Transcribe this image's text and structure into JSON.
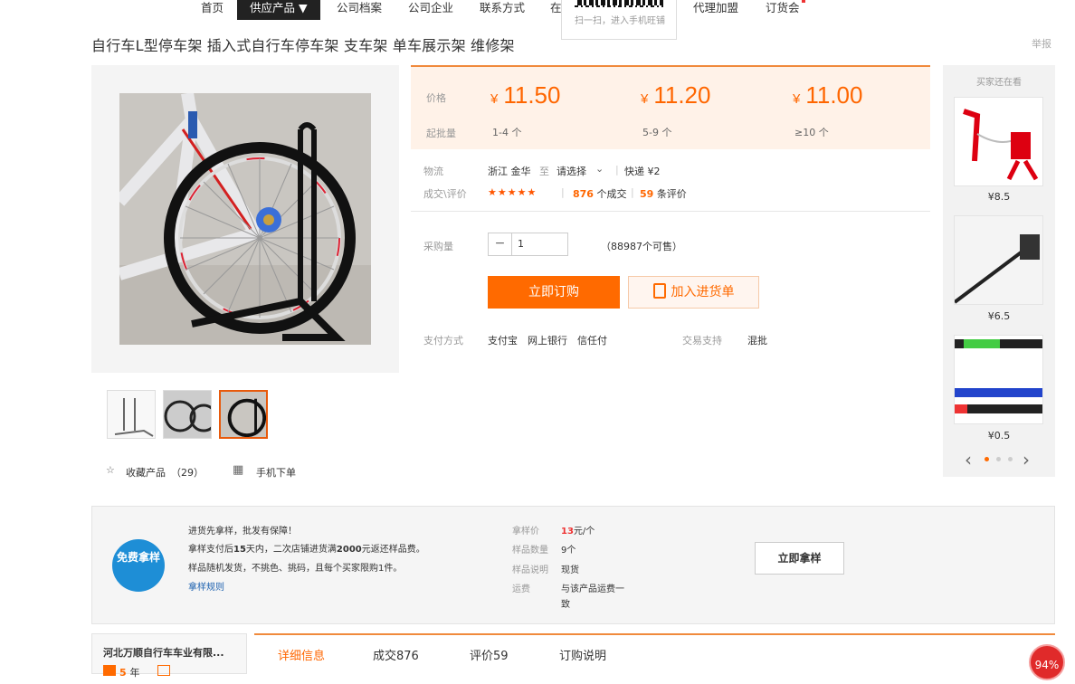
{
  "nav": {
    "items": [
      "首页",
      "供应产品 ▼",
      "公司档案",
      "公司企业",
      "联系方式",
      "在",
      "代理加盟",
      "订货会"
    ],
    "qr_text": "扫一扫，进入手机旺铺"
  },
  "product": {
    "title": "自行车L型停车架 插入式自行车停车架 支车架 单车展示架 维修架",
    "report": "举报"
  },
  "gallery": {
    "favorite_label": "收藏产品",
    "favorite_count": "（29）",
    "mobile_label": "手机下单"
  },
  "pricing": {
    "price_label": "价格",
    "moq_label": "起批量",
    "currency": "¥",
    "tiers": [
      {
        "price": "11.50",
        "range": "1-4 个"
      },
      {
        "price": "11.20",
        "range": "5-9 个"
      },
      {
        "price": "11.00",
        "range": "≥10 个"
      }
    ]
  },
  "logistics": {
    "label": "物流",
    "from": "浙江 金华",
    "to": "至",
    "select": "请选择",
    "express": "快递 ¥2"
  },
  "deals": {
    "label": "成交\\评价",
    "stars": "★★★★★",
    "deal_count": "876",
    "deal_suffix": "个成交",
    "review_count": "59",
    "review_suffix": "条评价"
  },
  "purchase": {
    "label": "采购量",
    "minus": "−",
    "quantity": "1",
    "available": "（88987个可售）",
    "buy_button": "立即订购",
    "cart_button": "加入进货单",
    "payment_label": "支付方式",
    "payment_methods": "支付宝　网上银行　信任付",
    "trade_label": "交易支持",
    "trade_value": "混批"
  },
  "sidebar": {
    "header": "买家还在看",
    "items": [
      {
        "price": "¥8.5"
      },
      {
        "price": "¥6.5"
      },
      {
        "price": "¥0.5"
      }
    ],
    "prev": "‹",
    "next": "›"
  },
  "sample": {
    "badge": "免费拿样",
    "line1": "进货先拿样，批发有保障！",
    "line2_a": "拿样支付后",
    "line2_b": "15",
    "line2_c": "天内，二次店铺进货满",
    "line2_d": "2000",
    "line2_e": "元返还样品费。",
    "line3": "样品随机发货，不挑色、挑码，且每个买家限购1件。",
    "rules_link": "拿样规则",
    "price_label": "拿样价",
    "price_value": "13",
    "price_unit": "元/个",
    "qty_label": "样品数量",
    "qty_value": "9个",
    "desc_label": "样品说明",
    "desc_value": "现货",
    "freight_label": "运费",
    "freight_value_1": "与该产品运费一",
    "freight_value_2": "致",
    "button": "立即拿样"
  },
  "shop": {
    "name": "河北万顺自行车车业有限...",
    "years": "5",
    "years_unit": "年"
  },
  "tabs": [
    "详细信息",
    "成交876",
    "评价59",
    "订购说明"
  ],
  "progress": "94%",
  "colors": {
    "accent": "#ff6a00",
    "badge_blue": "#1e8ed6"
  }
}
